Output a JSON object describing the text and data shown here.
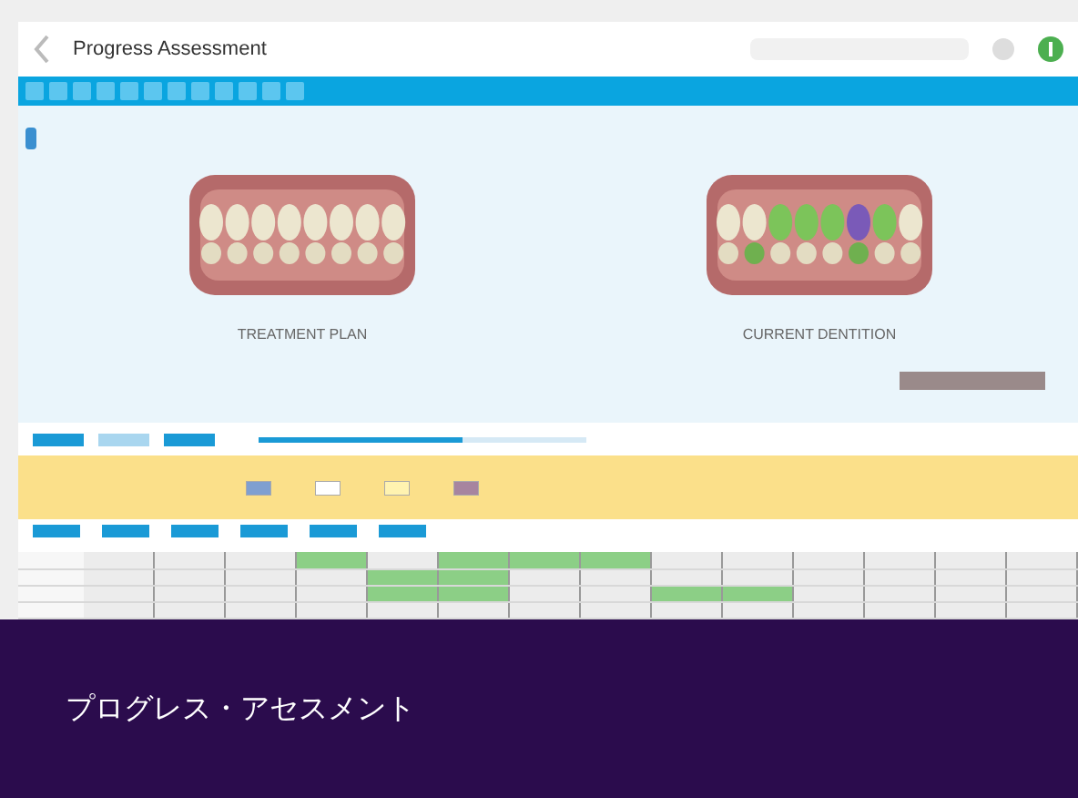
{
  "header": {
    "title": "Progress Assessment"
  },
  "viewer": {
    "left_label": "TREATMENT PLAN",
    "right_label": "CURRENT DENTITION"
  },
  "slider": {
    "level": 0.62
  },
  "grid": {
    "rows": [
      {
        "cells": [
          false,
          false,
          false,
          true,
          false,
          true,
          true,
          true,
          false,
          false,
          false,
          false,
          false,
          false
        ]
      },
      {
        "cells": [
          false,
          false,
          false,
          false,
          true,
          true,
          false,
          false,
          false,
          false,
          false,
          false,
          false,
          false
        ]
      },
      {
        "cells": [
          false,
          false,
          false,
          false,
          true,
          true,
          false,
          false,
          true,
          true,
          false,
          false,
          false,
          false
        ]
      },
      {
        "cells": [
          false,
          false,
          false,
          false,
          false,
          false,
          false,
          false,
          false,
          false,
          false,
          false,
          false,
          false
        ]
      }
    ]
  },
  "caption": "プログレス・アセスメント"
}
